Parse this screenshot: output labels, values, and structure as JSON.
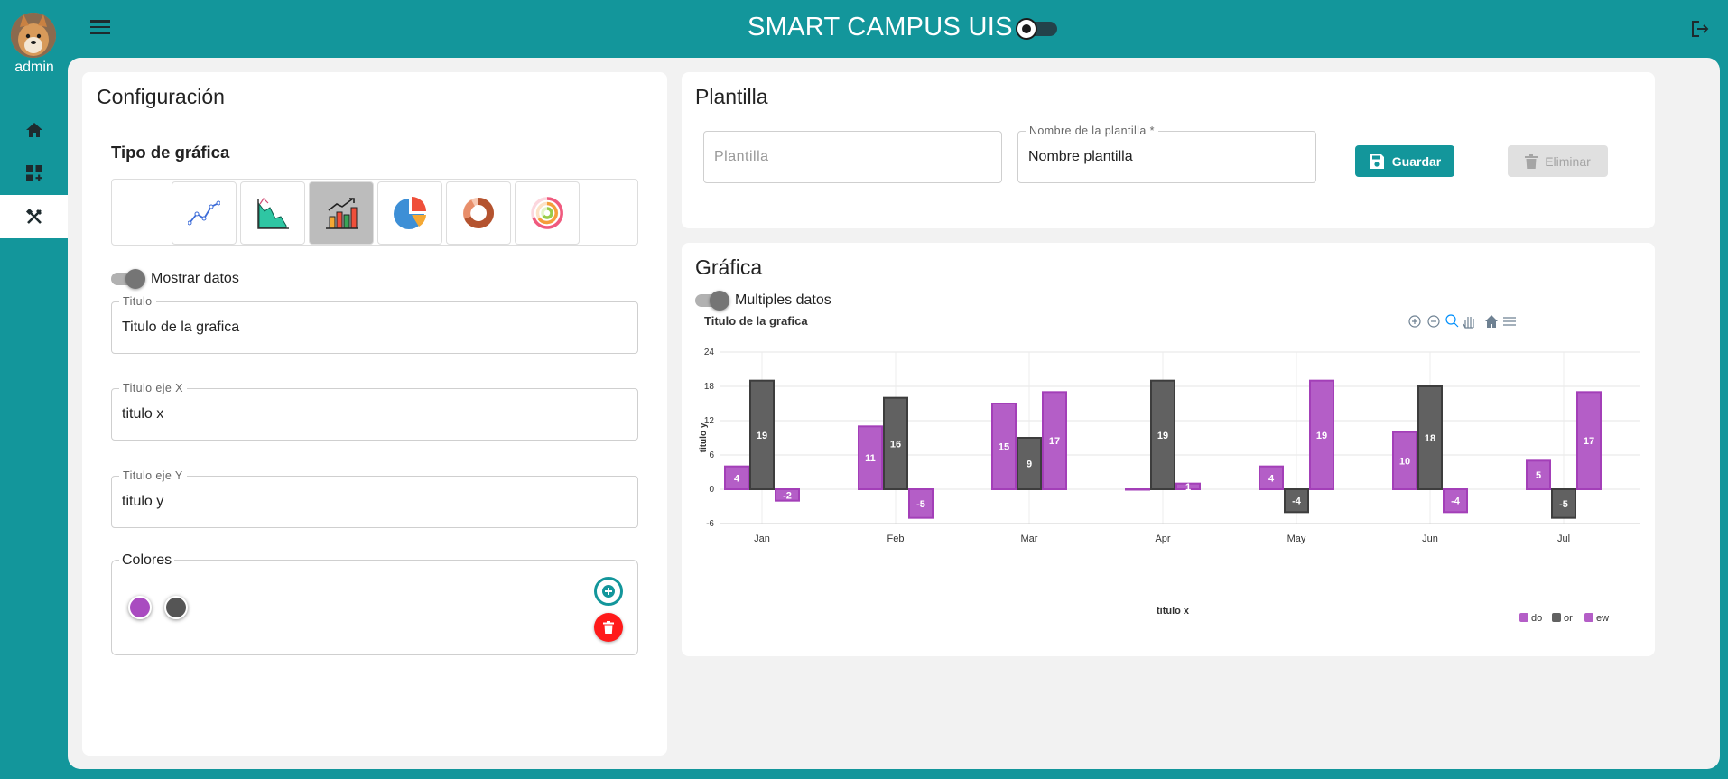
{
  "header": {
    "app_title": "SMART CAMPUS UIS",
    "user_name": "admin",
    "icons": {
      "menu": "menu-icon",
      "theme": "brightness-toggle-icon",
      "logout": "logout-icon"
    }
  },
  "sidebar": {
    "items": [
      {
        "icon": "home-icon",
        "active": false
      },
      {
        "icon": "dashboard-add-icon",
        "active": false
      },
      {
        "icon": "design-tools-icon",
        "active": true
      }
    ]
  },
  "config": {
    "title": "Configuración",
    "chart_type_label": "Tipo de gráfica",
    "chart_types": [
      {
        "icon": "line-chart-icon",
        "selected": false
      },
      {
        "icon": "area-chart-icon",
        "selected": false
      },
      {
        "icon": "bar-chart-icon",
        "selected": true
      },
      {
        "icon": "pie-chart-icon",
        "selected": false
      },
      {
        "icon": "donut-chart-icon",
        "selected": false
      },
      {
        "icon": "radial-bar-chart-icon",
        "selected": false
      }
    ],
    "show_data_label": "Mostrar datos",
    "title_field": {
      "label": "Titulo",
      "value": "Titulo de la grafica"
    },
    "x_field": {
      "label": "Titulo eje X",
      "value": "titulo x"
    },
    "y_field": {
      "label": "Titulo eje Y",
      "value": "titulo y"
    },
    "colors_label": "Colores",
    "colors": [
      "#a94bc0",
      "#555555"
    ]
  },
  "template": {
    "title": "Plantilla",
    "select_placeholder": "Plantilla",
    "name_field": {
      "label": "Nombre de la plantilla *",
      "value": "Nombre plantilla"
    },
    "save_label": "Guardar",
    "delete_label": "Eliminar"
  },
  "graph": {
    "title": "Gráfica",
    "multiple_label": "Multiples datos",
    "toolbar_icons": [
      "zoom-in-icon",
      "zoom-out-icon",
      "zoom-select-icon",
      "pan-hand-icon",
      "reset-home-icon",
      "chart-menu-icon"
    ]
  },
  "colors": {
    "accent": "#13969b",
    "purple": "#b45ec7",
    "gray": "#616161",
    "delete_red": "#ff1a1a"
  },
  "chart_data": {
    "type": "bar",
    "title": "Titulo de la grafica",
    "xlabel": "titulo x",
    "ylabel": "titulo y",
    "categories": [
      "Jan",
      "Feb",
      "Mar",
      "Apr",
      "May",
      "Jun",
      "Jul"
    ],
    "ylim": [
      -6,
      24
    ],
    "yticks": [
      24,
      18,
      12,
      6,
      0,
      -6
    ],
    "legend_position": "bottom-right",
    "series": [
      {
        "name": "do",
        "color": "#b45ec7",
        "values": [
          4,
          11,
          15,
          0,
          4,
          10,
          5
        ]
      },
      {
        "name": "or",
        "color": "#616161",
        "values": [
          19,
          16,
          9,
          19,
          -4,
          18,
          -5
        ]
      },
      {
        "name": "ew",
        "color": "#b45ec7",
        "values": [
          -2,
          -5,
          17,
          1,
          19,
          -4,
          17
        ]
      }
    ]
  }
}
